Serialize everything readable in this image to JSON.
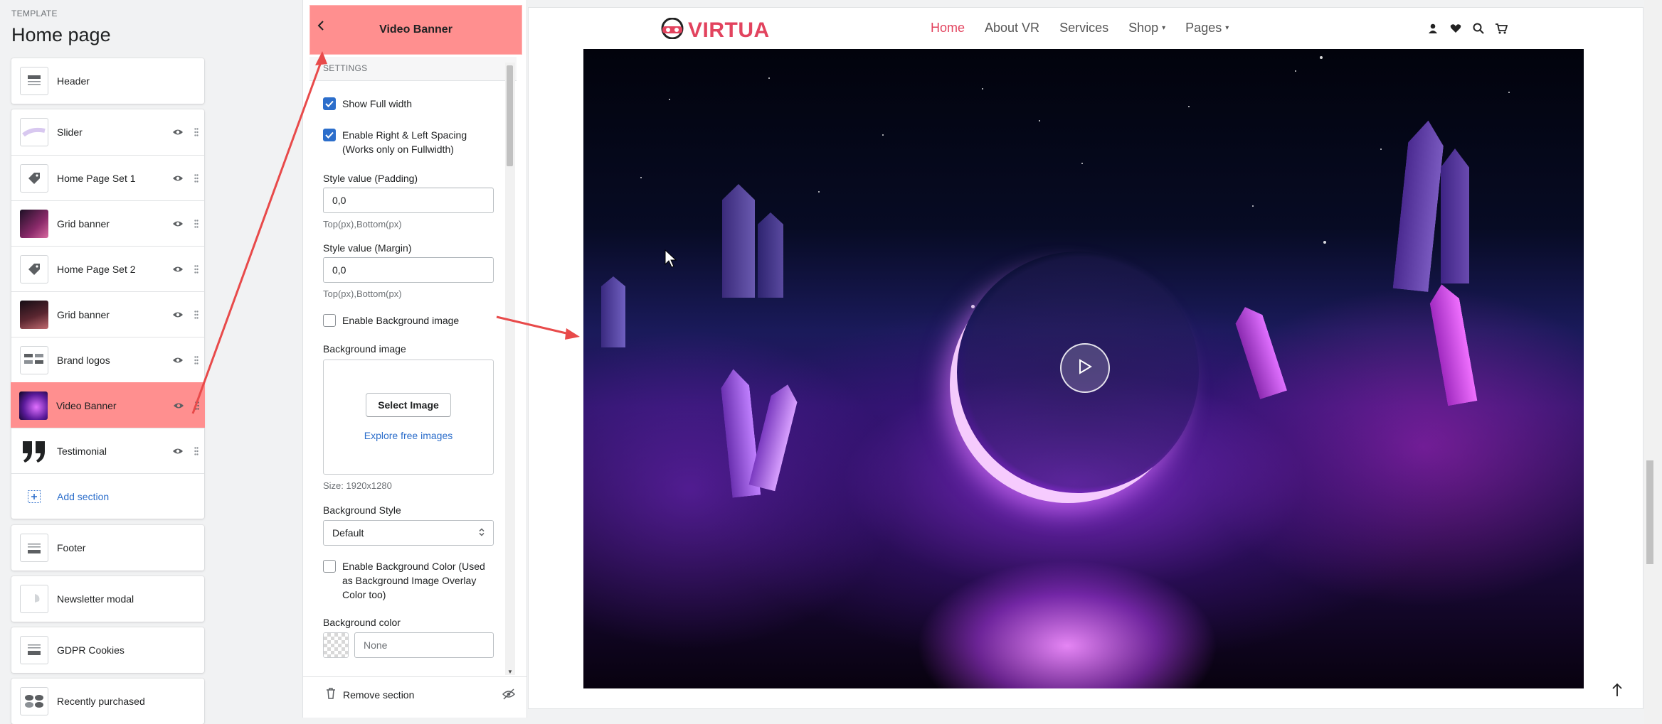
{
  "editor": {
    "template_caption": "TEMPLATE",
    "page_title": "Home page",
    "sections": {
      "header": "Header",
      "body": [
        {
          "label": "Slider"
        },
        {
          "label": "Home Page Set 1"
        },
        {
          "label": "Grid banner"
        },
        {
          "label": "Home Page Set 2"
        },
        {
          "label": "Grid banner"
        },
        {
          "label": "Brand logos"
        },
        {
          "label": "Video Banner"
        },
        {
          "label": "Testimonial"
        }
      ],
      "add_section": "Add section",
      "footer": "Footer",
      "newsletter": "Newsletter modal",
      "gdpr": "GDPR Cookies",
      "recent": "Recently purchased"
    },
    "highlight_color": "#ff8f8f"
  },
  "panel": {
    "title": "Video Banner",
    "settings_header": "SETTINGS",
    "show_full_width": "Show Full width",
    "enable_spacing": "Enable Right & Left Spacing (Works only on Fullwidth)",
    "padding_label": "Style value (Padding)",
    "padding_value": "0,0",
    "padding_help": "Top(px),Bottom(px)",
    "margin_label": "Style value (Margin)",
    "margin_value": "0,0",
    "margin_help": "Top(px),Bottom(px)",
    "enable_bg_image": "Enable Background image",
    "bg_image_label": "Background image",
    "select_image": "Select Image",
    "explore_images": "Explore free images",
    "size_note": "Size: 1920x1280",
    "bg_style_label": "Background Style",
    "bg_style_value": "Default",
    "enable_bg_color": "Enable Background Color (Used as Background Image Overlay Color too)",
    "bg_color_label": "Background color",
    "bg_color_value": "None",
    "remove_section": "Remove section"
  },
  "site": {
    "logo_text": "VIRTUA",
    "brand_color": "#e2435e",
    "menu": [
      "Home",
      "About VR",
      "Services",
      "Shop",
      "Pages"
    ],
    "icons": [
      "user-icon",
      "heart-icon",
      "search-icon",
      "cart-icon"
    ]
  }
}
